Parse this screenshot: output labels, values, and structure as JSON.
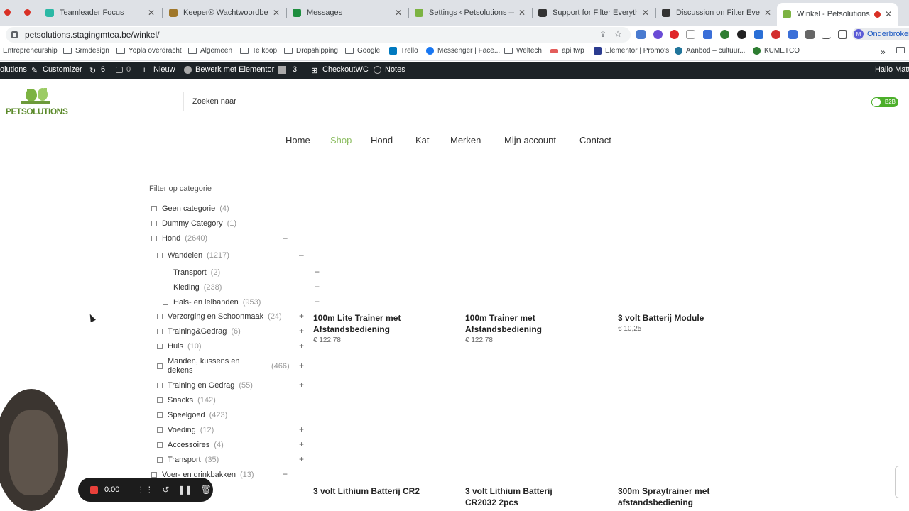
{
  "browser": {
    "tabs": [
      {
        "title": "Teamleader Focus",
        "color": "#2bb8a5"
      },
      {
        "title": "Keeper® Wachtwoordbeheer",
        "color": "#a0772a"
      },
      {
        "title": "Messages",
        "color": "#1e8e3e"
      },
      {
        "title": "Settings ‹ Petsolutions — Wo",
        "color": "#7cb342"
      },
      {
        "title": "Support for Filter Everything",
        "color": "#333333"
      },
      {
        "title": "Discussion on Filter Everythin",
        "color": "#333333"
      },
      {
        "title": "Winkel - Petsolutions",
        "color": "#7cb342"
      }
    ],
    "url": "petsolutions.stagingmtea.be/winkel/",
    "profile_label": "Onderbroken",
    "profile_initial": "M",
    "bookmarks": [
      "Entrepreneurship",
      "Srmdesign",
      "Yopla overdracht",
      "Algemeen",
      "Te koop",
      "Dropshipping",
      "Google",
      "Trello",
      "Messenger | Face...",
      "Weltech",
      "api twp",
      "Elementor | Promo's",
      "Aanbod – cultuur...",
      "KUMETCO"
    ]
  },
  "wp_admin": {
    "site": "olutions",
    "customizer": "Customizer",
    "updates": "6",
    "comments": "0",
    "new": "Nieuw",
    "elementor": "Bewerk met Elementor",
    "yoast": "3",
    "checkout": "CheckoutWC",
    "notes": "Notes",
    "greeting": "Hallo Matt"
  },
  "site": {
    "logo_text": "PETSOLUTIONS",
    "search_placeholder": "Zoeken naar",
    "b2b_label": "B2B",
    "nav": [
      "Home",
      "Shop",
      "Hond",
      "Kat",
      "Merken",
      "Mijn account",
      "Contact"
    ],
    "active_nav": "Shop",
    "accent": "#7cb342"
  },
  "filter": {
    "title": "Filter op categorie",
    "items": [
      {
        "label": "Geen categorie",
        "count": "(4)",
        "toggle": ""
      },
      {
        "label": "Dummy Category",
        "count": "(1)",
        "toggle": ""
      },
      {
        "label": "Hond",
        "count": "(2640)",
        "toggle": "–"
      },
      {
        "label": "Wandelen",
        "count": "(1217)",
        "toggle": "–"
      },
      {
        "label": "Transport",
        "count": "(2)",
        "toggle": "+"
      },
      {
        "label": "Kleding",
        "count": "(238)",
        "toggle": "+"
      },
      {
        "label": "Hals- en leibanden",
        "count": "(953)",
        "toggle": "+"
      },
      {
        "label": "Verzorging en Schoonmaak",
        "count": "(24)",
        "toggle": "+"
      },
      {
        "label": "Training&Gedrag",
        "count": "(6)",
        "toggle": "+"
      },
      {
        "label": "Huis",
        "count": "(10)",
        "toggle": "+"
      },
      {
        "label": "Manden, kussens en dekens",
        "count": "(466)",
        "toggle": "+"
      },
      {
        "label": "Training en Gedrag",
        "count": "(55)",
        "toggle": "+"
      },
      {
        "label": "Snacks",
        "count": "(142)",
        "toggle": ""
      },
      {
        "label": "Speelgoed",
        "count": "(423)",
        "toggle": ""
      },
      {
        "label": "Voeding",
        "count": "(12)",
        "toggle": "+"
      },
      {
        "label": "Accessoires",
        "count": "(4)",
        "toggle": "+"
      },
      {
        "label": "Transport",
        "count": "(35)",
        "toggle": "+"
      },
      {
        "label": "Voer- en drinkbakken",
        "count": "(13)",
        "toggle": "+"
      }
    ]
  },
  "products": [
    {
      "title": "100m Lite Trainer met Afstandsbediening",
      "price": "€ 122,78"
    },
    {
      "title": "100m Trainer met Afstandsbediening",
      "price": "€ 122,78"
    },
    {
      "title": "3 volt Batterij Module",
      "price": "€ 10,25"
    },
    {
      "title": "3 volt Lithium Batterij CR2",
      "price": ""
    },
    {
      "title": "3 volt Lithium Batterij CR2032 2pcs",
      "price": ""
    },
    {
      "title": "300m Spraytrainer met afstandsbediening",
      "price": ""
    }
  ],
  "recorder": {
    "time": "0:00"
  }
}
